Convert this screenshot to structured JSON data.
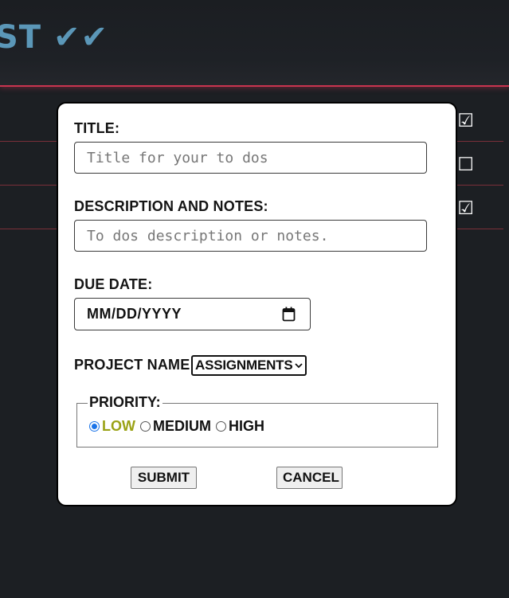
{
  "background": {
    "title": "ST ✔✔",
    "rows": [
      {
        "check_glyph": "☑"
      },
      {
        "check_glyph": "☐"
      },
      {
        "check_glyph": "☑"
      }
    ]
  },
  "modal": {
    "title_label": "TITLE:",
    "title_placeholder": "Title for your to dos",
    "description_label": "DESCRIPTION AND NOTES:",
    "description_placeholder": "To dos description or notes.",
    "due_date_label": "DUE DATE:",
    "due_date_value": "MM/DD/YYYY",
    "project_label": "PROJECT NAME:",
    "project_selected": "ASSIGNMENTS",
    "priority": {
      "legend": "PRIORITY:",
      "options": [
        {
          "label": "LOW",
          "checked": true
        },
        {
          "label": "MEDIUM",
          "checked": false
        },
        {
          "label": "HIGH",
          "checked": false
        }
      ]
    },
    "submit_label": "SUBMIT",
    "cancel_label": "CANCEL"
  },
  "colors": {
    "background": "#1c1f23",
    "accent_line": "#c9344f",
    "title_blue": "#5b97b8",
    "selected_priority": "#9aa215",
    "radio_blue": "#1a73e8"
  },
  "icons": {
    "date_picker": "calendar-icon",
    "select_arrow": "chevron-down-icon"
  }
}
